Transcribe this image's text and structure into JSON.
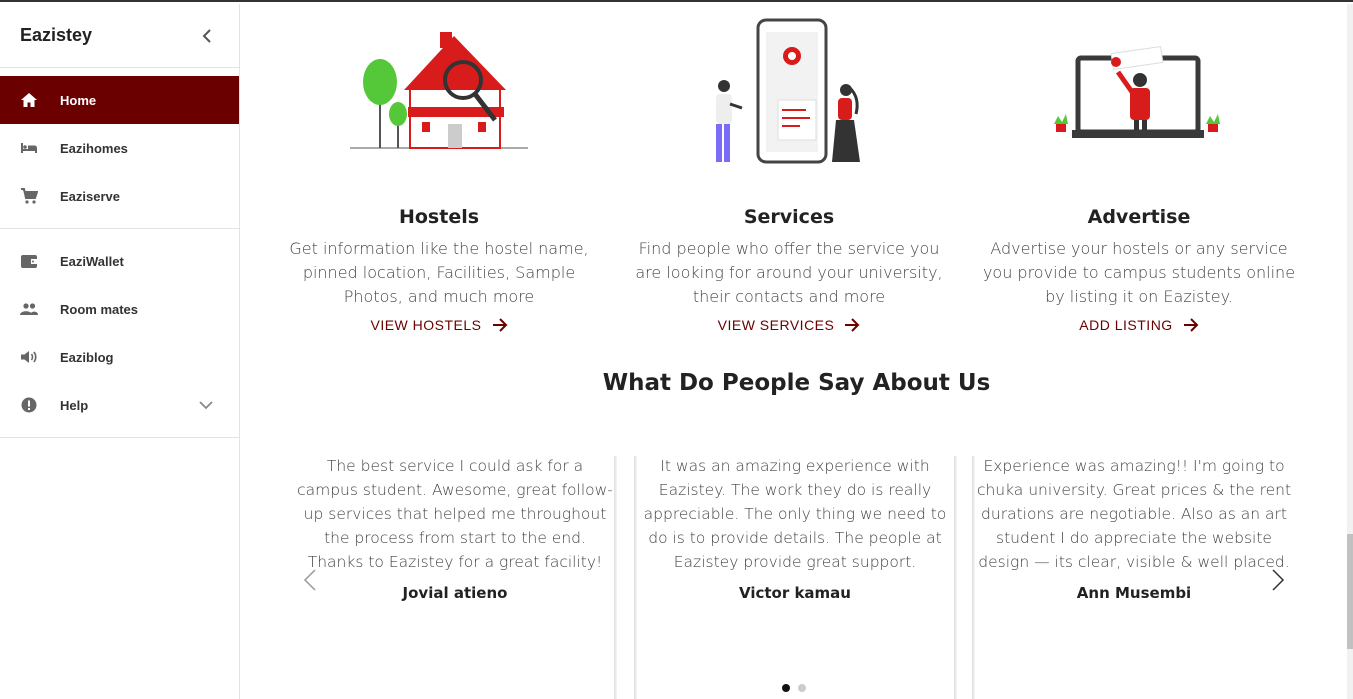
{
  "sidebar": {
    "brand": "Eazistey",
    "items_main": [
      {
        "label": "Home",
        "icon": "home-icon",
        "active": true
      },
      {
        "label": "Eazihomes",
        "icon": "bed-icon"
      },
      {
        "label": "Eaziserve",
        "icon": "cart-icon"
      }
    ],
    "items_secondary": [
      {
        "label": "EaziWallet",
        "icon": "wallet-icon"
      },
      {
        "label": "Room mates",
        "icon": "people-icon"
      },
      {
        "label": "Eaziblog",
        "icon": "speaker-icon"
      },
      {
        "label": "Help",
        "icon": "alert-icon"
      }
    ]
  },
  "cards": [
    {
      "title": "Hostels",
      "desc": "Get information like the hostel name, pinned location, Facilities, Sample Photos, and much more",
      "link": "VIEW HOSTELS"
    },
    {
      "title": "Services",
      "desc": "Find people who offer the service you are looking for around your university, their contacts and more",
      "link": "VIEW SERVICES"
    },
    {
      "title": "Advertise",
      "desc": "Advertise your hostels or any service you provide to campus students online by listing it on Eazistey.",
      "link": "ADD LISTING"
    }
  ],
  "testimonials_section": {
    "title": "What Do People Say About Us",
    "items": [
      {
        "quote": "The best service I could ask for a campus student. Awesome, great follow-up services that helped me throughout the process from start to the end. Thanks to Eazistey for a great facility!",
        "name": "Jovial atieno"
      },
      {
        "quote": "It was an amazing experience with Eazistey. The work they do is really appreciable. The only thing we need to do is to provide details. The people at Eazistey provide great support.",
        "name": "Victor kamau"
      },
      {
        "quote": "Experience was amazing!! I'm going to chuka university. Great prices & the rent durations are negotiable. Also as an art student I do appreciate the website design — its clear, visible & well placed.",
        "name": "Ann Musembi"
      }
    ]
  },
  "colors": {
    "accent": "#6b0000",
    "red": "#d81b1b",
    "green": "#55c83a"
  }
}
